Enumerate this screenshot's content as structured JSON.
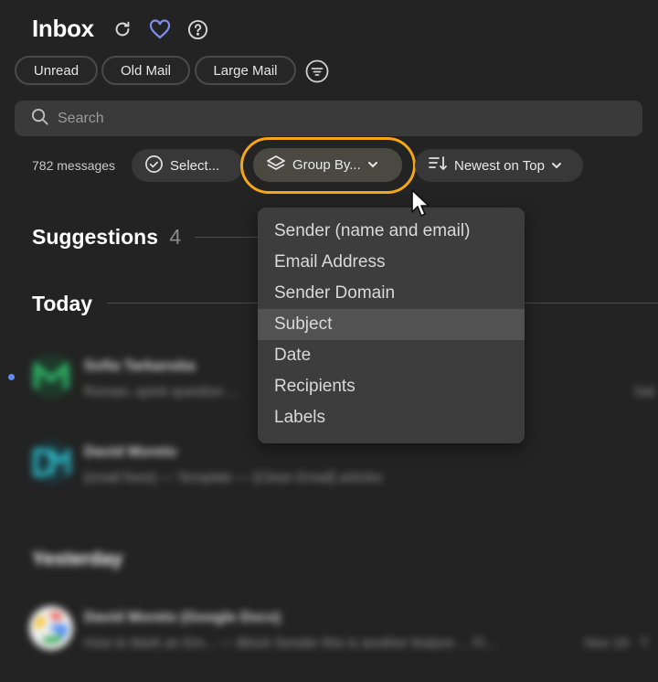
{
  "header": {
    "title": "Inbox",
    "icons": [
      "refresh-icon",
      "heart-icon",
      "help-icon"
    ]
  },
  "filters": {
    "chips": [
      "Unread",
      "Old Mail",
      "Large Mail"
    ],
    "filter_icon": "filter-icon"
  },
  "search": {
    "placeholder": "Search"
  },
  "toolbar": {
    "count": "782 messages",
    "select_label": "Select...",
    "group_by_label": "Group By...",
    "sort_label": "Newest on Top"
  },
  "sections": {
    "suggestions": {
      "title": "Suggestions",
      "count": "4"
    },
    "today": {
      "title": "Today"
    },
    "yesterday": {
      "title": "Yesterday"
    }
  },
  "group_menu": {
    "items": [
      "Sender (name and email)",
      "Email Address",
      "Sender Domain",
      "Subject",
      "Date",
      "Recipients",
      "Labels"
    ],
    "highlighted": "Subject"
  },
  "rows": [
    {
      "sender": "Sofia Tarkanska",
      "snippet": "Roman, quick question ...",
      "time": "Sat"
    },
    {
      "sender": "David Moreto",
      "snippet": "[small fixes] — Template — [Clean Email] articles",
      "time": ""
    },
    {
      "sender": "David Moreto (Google Docs)",
      "snippet": "How to Mark an Em... — Block Sender this is another feature ... Fi...",
      "time": "Nov 19 · T"
    }
  ],
  "colors": {
    "accent_ring": "#f4a61a",
    "heart": "#7f8cf0",
    "background": "#232323"
  }
}
